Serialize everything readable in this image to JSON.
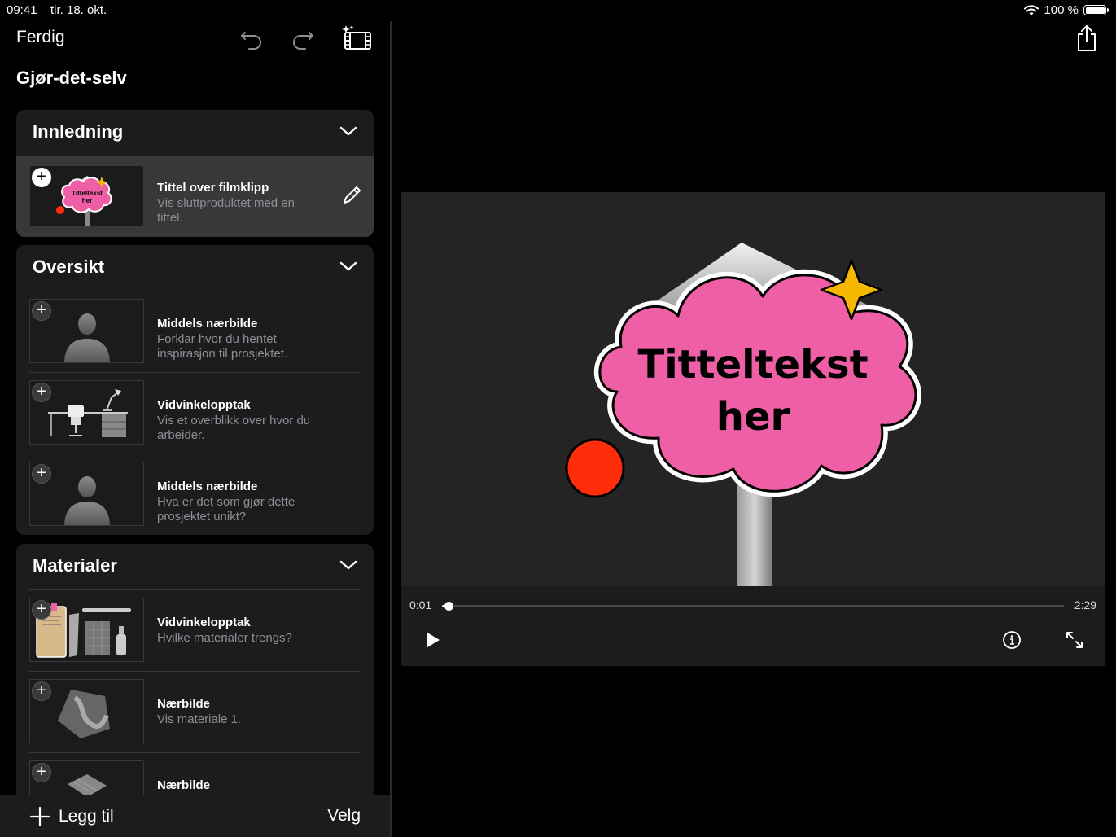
{
  "status": {
    "time": "09:41",
    "date": "tir. 18. okt.",
    "battery": "100 %",
    "battery_level": 1.0
  },
  "nav": {
    "done": "Ferdig",
    "project_title": "Gjør-det-selv"
  },
  "sections": [
    {
      "title": "Innledning",
      "rows": [
        {
          "title": "Tittel over filmklipp",
          "subtitle": "Vis sluttproduktet med en tittel.",
          "thumb_text_line1": "Titteltekst",
          "thumb_text_line2": "her"
        }
      ]
    },
    {
      "title": "Oversikt",
      "rows": [
        {
          "title": "Middels nærbilde",
          "subtitle": "Forklar hvor du hentet inspirasjon til prosjektet."
        },
        {
          "title": "Vidvinkelopptak",
          "subtitle": "Vis et overblikk over hvor du arbeider."
        },
        {
          "title": "Middels nærbilde",
          "subtitle": "Hva er det som gjør dette prosjektet unikt?"
        }
      ]
    },
    {
      "title": "Materialer",
      "rows": [
        {
          "title": "Vidvinkelopptak",
          "subtitle": "Hvilke materialer trengs?"
        },
        {
          "title": "Nærbilde",
          "subtitle": "Vis materiale 1."
        },
        {
          "title": "Nærbilde",
          "subtitle": ""
        }
      ]
    }
  ],
  "bottom": {
    "add": "Legg til",
    "select": "Velg"
  },
  "player": {
    "preview_text_line1": "Titteltekst",
    "preview_text_line2": "her",
    "current_time": "0:01",
    "total_time": "2:29",
    "progress": 0.01
  },
  "colors": {
    "pink": "#ee5fa5",
    "red_dot": "#ff2d0a",
    "star": "#f5b800"
  }
}
